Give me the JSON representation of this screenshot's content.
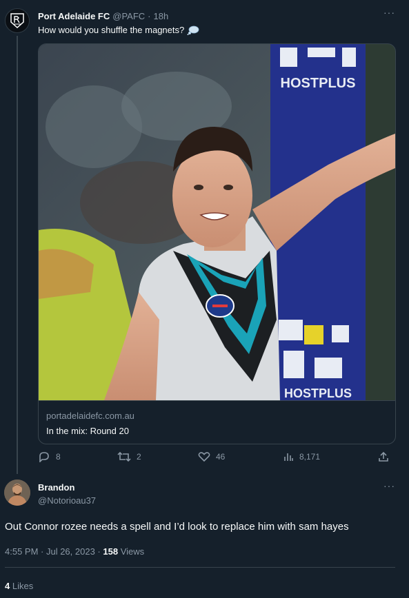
{
  "tweet": {
    "author_name": "Port Adelaide FC",
    "author_handle": "@PAFC",
    "time": "18h",
    "text": "How would you shuffle the magnets?",
    "emoji_icon": "thought-balloon-icon",
    "card": {
      "image_banner_text": "HOSTPLUS",
      "domain": "portadelaidefc.com.au",
      "title": "In the mix: Round 20"
    },
    "actions": {
      "replies": "8",
      "retweets": "2",
      "likes": "46",
      "views": "8,171"
    }
  },
  "reply": {
    "author_name": "Brandon",
    "author_handle": "@Notorioau37",
    "text": "Out Connor rozee needs a spell and I’d look to replace him with sam hayes",
    "timestamp": "4:55 PM · Jul 26, 2023 ·",
    "views_count": "158",
    "views_label": "Views",
    "likes_count": "4",
    "likes_label": "Likes"
  },
  "colors": {
    "background": "#15202b",
    "border": "#38444d",
    "muted_text": "#8b98a5",
    "primary_text": "#f7f9f9"
  }
}
